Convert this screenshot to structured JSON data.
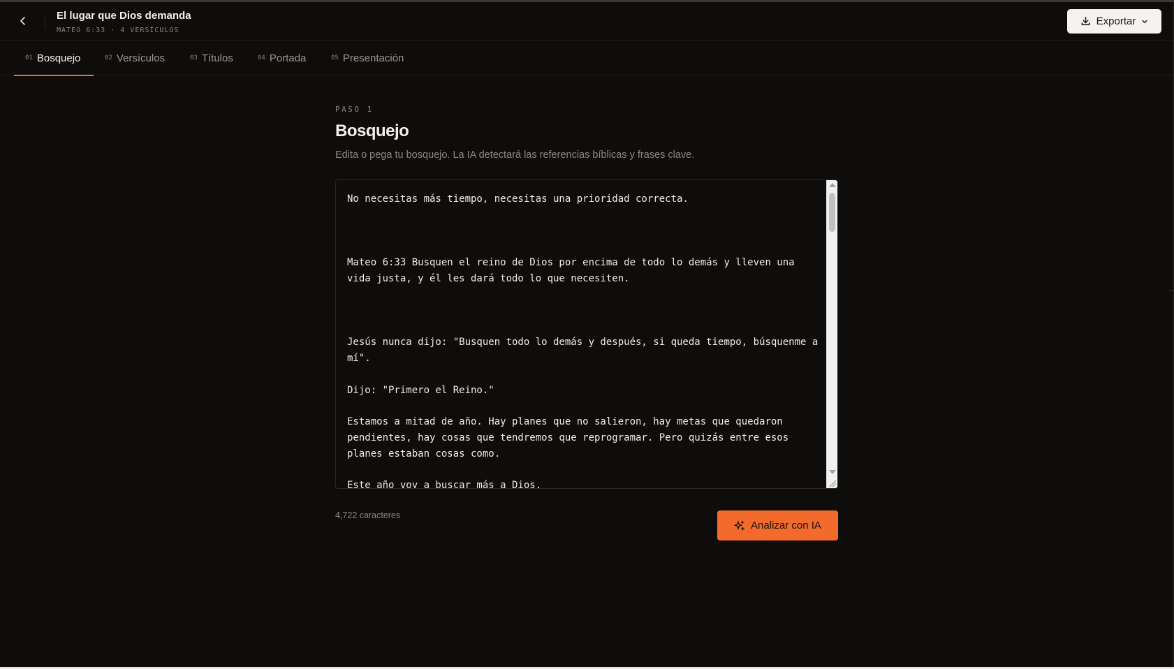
{
  "header": {
    "title": "El lugar que Dios demanda",
    "meta": "MATEO 6:33 · 4 VERSÍCULOS",
    "back_icon": "chevron-left-icon",
    "export_label": "Exportar",
    "export_icon": "download-icon",
    "export_caret_icon": "chevron-down-icon"
  },
  "tabs": [
    {
      "num": "01",
      "label": "Bosquejo",
      "active": true
    },
    {
      "num": "02",
      "label": "Versículos",
      "active": false
    },
    {
      "num": "03",
      "label": "Títulos",
      "active": false
    },
    {
      "num": "04",
      "label": "Portada",
      "active": false
    },
    {
      "num": "05",
      "label": "Presentación",
      "active": false
    }
  ],
  "main": {
    "step": "PASO 1",
    "title": "Bosquejo",
    "description": "Edita o pega tu bosquejo. La IA detectará las referencias bíblicas y frases clave.",
    "editor_value": "No necesitas más tiempo, necesitas una prioridad correcta.\n\n\n\nMateo 6:33 Busquen el reino de Dios por encima de todo lo demás y lleven una vida justa, y él les dará todo lo que necesiten.\n\n\n\nJesús nunca dijo: \"Busquen todo lo demás y después, si queda tiempo, búsquenme a mí\".\n\nDijo: \"Primero el Reino.\"\n\nEstamos a mitad de año. Hay planes que no salieron, hay metas que quedaron pendientes, hay cosas que tendremos que reprogramar. Pero quizás entre esos planes estaban cosas como.\n\nEste año voy a buscar más a Dios.",
    "char_count": "4,722 caracteres",
    "analyze_label": "Analizar con IA",
    "analyze_icon": "sparkles-icon"
  },
  "colors": {
    "background": "#0f0d0b",
    "accent": "#f26b2c",
    "text": "#f4f1ec",
    "muted": "#8e877f"
  }
}
